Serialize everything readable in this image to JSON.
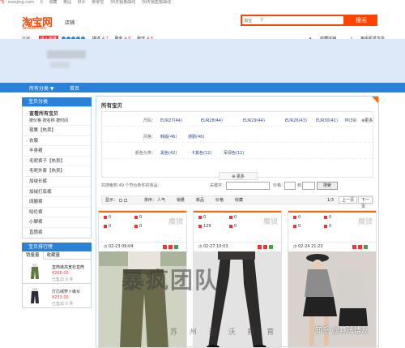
{
  "topstrip": {
    "logo": "飞",
    "items": [
      "moojing.com",
      "0",
      "收藏",
      "黄冠",
      "0",
      "好评",
      "0",
      "卖家信",
      "0",
      "30天销量曲线",
      "0",
      "30天销售额曲线",
      "0"
    ]
  },
  "header": {
    "logo": "淘宝网",
    "logo_sub": "Taobao.com",
    "shop_label": "店铺",
    "search_select": "淘宝",
    "search_placeholder": "",
    "search_button": "搜索"
  },
  "seller": {
    "label": "店铺：",
    "tag": "进入店铺",
    "scores": [
      {
        "label": "描述",
        "value": "4.7"
      },
      {
        "label": "服务",
        "value": "4.8"
      },
      {
        "label": "物流",
        "value": "4.8"
      }
    ],
    "collect": "收藏店铺",
    "mobile": "用手机逛本店"
  },
  "nav": {
    "items": [
      "所有分类 ▼",
      "首页"
    ]
  },
  "sidebar": {
    "header": "宝贝分类",
    "all": "查看所有宝贝",
    "sub": "按价格 按名称 按时间",
    "items": [
      "夜鹰【热卖】",
      "衣服",
      "半身裙",
      "毛呢裤子【热卖】",
      "毛呢外套【热卖】",
      "加绒长裤",
      "加绒打底裤",
      "阔腿裤",
      "哈伦裤",
      "小脚裤",
      "直筒裤"
    ]
  },
  "rank": {
    "header": "宝贝排行榜",
    "tabs": [
      "销量量",
      "收藏量"
    ],
    "items": [
      {
        "name": "直筒裤高宽松直筒",
        "price": "¥268.00",
        "sold": "已售出 0 件",
        "color": "#5e7a3a"
      },
      {
        "name": "灯芯绒萝卜裤女",
        "price": "¥233.00",
        "sold": "已售出 0 件",
        "color": "#2b2b3a"
      }
    ]
  },
  "main": {
    "title": "所有宝贝",
    "attrs": [
      {
        "label": "尺码：",
        "values": [
          "EUR27(44)",
          "EUR28(44)",
          "EUR29(44)",
          "EUR26(43)",
          "EUR30(41)",
          "M(39)"
        ],
        "more": "更多"
      },
      {
        "label": "风格：",
        "values": [
          "韩版(46)",
          "通勤(46)"
        ]
      },
      {
        "label": "颜色分类：",
        "values": [
          "黑色(42)",
          "卡其色(12)",
          "军绿色(12)"
        ]
      }
    ],
    "more_btn": "更多",
    "result": "共搜索到 49 个符合条件的商品：",
    "keyword_label": "关键字：",
    "price_label": "价格：",
    "price_to": "到",
    "search_btn": "搜索",
    "sort": {
      "display": "显示：",
      "items": [
        "排序：",
        "人气",
        "销量",
        "新品",
        "价格",
        "收藏"
      ],
      "page": "1/3",
      "prev": "上一页",
      "next": "下一页"
    },
    "cards": [
      {
        "l1": "0",
        "l2": "0",
        "r1": "0",
        "r2": "0",
        "mojing": "魔镜",
        "date": "02-23 09:04",
        "bg": "#cfd4c2",
        "garment": "#6b6a4a"
      },
      {
        "l1": "0",
        "l2": "129",
        "r1": "0",
        "r2": "0",
        "mojing": "魔镜",
        "date": "02-27 10:03",
        "bg": "#e3e3e3",
        "garment": "#2d2a2a"
      },
      {
        "l1": "0",
        "l2": "0",
        "r1": "0",
        "r2": "0",
        "mojing": "魔镜",
        "date": "02-24 21:23",
        "bg": "#d9d2cc",
        "garment": "#222222"
      }
    ]
  },
  "watermark": {
    "main": "暴疯团队",
    "sub": "苏 州 达 沃 教 育",
    "zhihu": "知乎 @算法博友"
  }
}
